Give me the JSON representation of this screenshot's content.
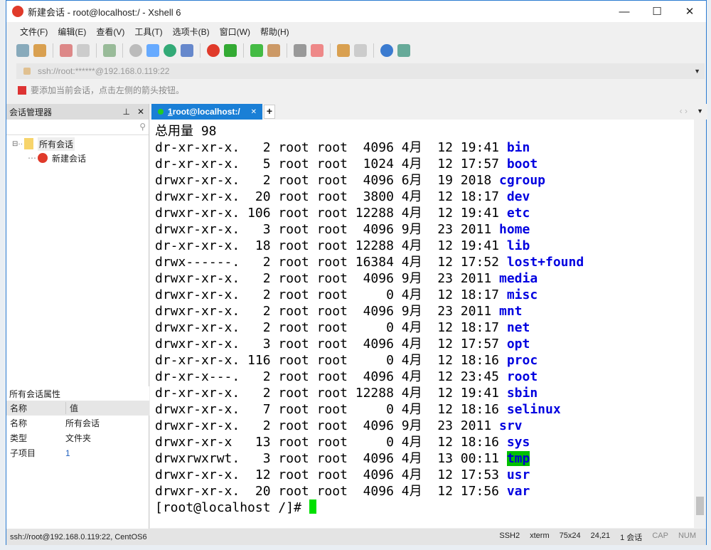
{
  "window": {
    "title": "新建会话 - root@localhost:/ - Xshell 6"
  },
  "menu": [
    "文件(F)",
    "编辑(E)",
    "查看(V)",
    "工具(T)",
    "选项卡(B)",
    "窗口(W)",
    "帮助(H)"
  ],
  "address": "ssh://root:******@192.168.0.119:22",
  "hint": "要添加当前会话，点击左侧的箭头按钮。",
  "session_manager": {
    "title": "会话管理器",
    "tree": [
      {
        "label": "所有会话",
        "icon": "folder-icon"
      },
      {
        "label": "新建会话",
        "icon": "xshell-session-icon"
      }
    ],
    "props_title": "所有会话属性",
    "props_header": [
      "名称",
      "值"
    ],
    "props": [
      [
        "名称",
        "所有会话"
      ],
      [
        "类型",
        "文件夹"
      ],
      [
        "子项目",
        "1"
      ]
    ]
  },
  "tab": {
    "num": "1",
    "label": " root@localhost:/"
  },
  "terminal": {
    "header": "总用量 98",
    "lines": [
      {
        "p": "dr-xr-xr-x.   2 root root  4096 4月  12 19:41 ",
        "n": "bin"
      },
      {
        "p": "dr-xr-xr-x.   5 root root  1024 4月  12 17:57 ",
        "n": "boot"
      },
      {
        "p": "drwxr-xr-x.   2 root root  4096 6月  19 2018 ",
        "n": "cgroup"
      },
      {
        "p": "drwxr-xr-x.  20 root root  3800 4月  12 18:17 ",
        "n": "dev"
      },
      {
        "p": "drwxr-xr-x. 106 root root 12288 4月  12 19:41 ",
        "n": "etc"
      },
      {
        "p": "drwxr-xr-x.   3 root root  4096 9月  23 2011 ",
        "n": "home"
      },
      {
        "p": "dr-xr-xr-x.  18 root root 12288 4月  12 19:41 ",
        "n": "lib"
      },
      {
        "p": "drwx------.   2 root root 16384 4月  12 17:52 ",
        "n": "lost+found"
      },
      {
        "p": "drwxr-xr-x.   2 root root  4096 9月  23 2011 ",
        "n": "media"
      },
      {
        "p": "drwxr-xr-x.   2 root root     0 4月  12 18:17 ",
        "n": "misc"
      },
      {
        "p": "drwxr-xr-x.   2 root root  4096 9月  23 2011 ",
        "n": "mnt"
      },
      {
        "p": "drwxr-xr-x.   2 root root     0 4月  12 18:17 ",
        "n": "net"
      },
      {
        "p": "drwxr-xr-x.   3 root root  4096 4月  12 17:57 ",
        "n": "opt"
      },
      {
        "p": "dr-xr-xr-x. 116 root root     0 4月  12 18:16 ",
        "n": "proc"
      },
      {
        "p": "dr-xr-x---.   2 root root  4096 4月  12 23:45 ",
        "n": "root"
      },
      {
        "p": "dr-xr-xr-x.   2 root root 12288 4月  12 19:41 ",
        "n": "sbin"
      },
      {
        "p": "drwxr-xr-x.   7 root root     0 4月  12 18:16 ",
        "n": "selinux"
      },
      {
        "p": "drwxr-xr-x.   2 root root  4096 9月  23 2011 ",
        "n": "srv"
      },
      {
        "p": "drwxr-xr-x   13 root root     0 4月  12 18:16 ",
        "n": "sys"
      },
      {
        "p": "drwxrwxrwt.   3 root root  4096 4月  13 00:11 ",
        "n": "tmp",
        "hl": true
      },
      {
        "p": "drwxr-xr-x.  12 root root  4096 4月  12 17:53 ",
        "n": "usr"
      },
      {
        "p": "drwxr-xr-x.  20 root root  4096 4月  12 17:56 ",
        "n": "var"
      }
    ],
    "prompt": "[root@localhost /]# "
  },
  "status": {
    "left": "ssh://root@192.168.0.119:22, CentOS6",
    "items": [
      "SSH2",
      "xterm",
      "75x24",
      "24,21",
      "1 会话",
      "CAP",
      "NUM"
    ]
  },
  "colors": {
    "accent": "#1a7fd6",
    "dir": "#0000e0",
    "highlight": "#00c000"
  }
}
